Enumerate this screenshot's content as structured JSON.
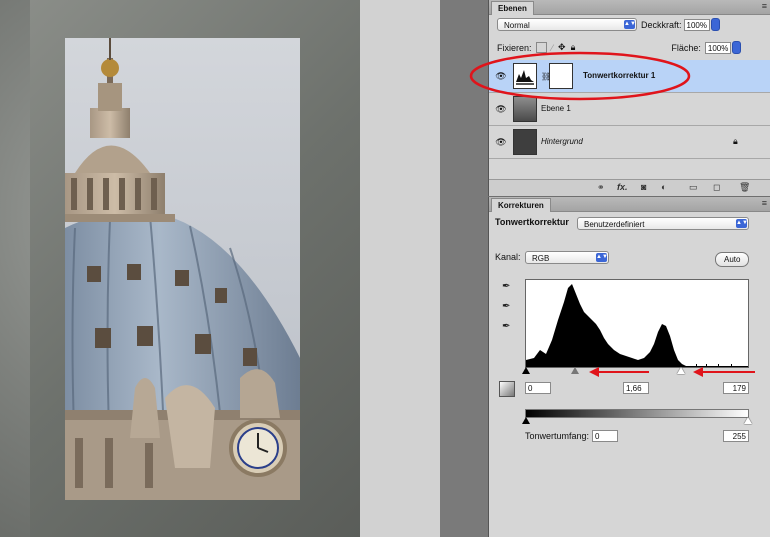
{
  "layers_panel": {
    "tab": "Ebenen",
    "menu_icon": "≡",
    "blend_mode": "Normal",
    "opacity_label": "Deckkraft:",
    "opacity_value": "100%",
    "lock_label": "Fixieren:",
    "fill_label": "Fläche:",
    "fill_value": "100%",
    "layers": [
      {
        "name": "Tonwertkorrektur 1",
        "selected": true
      },
      {
        "name": "Ebene 1",
        "selected": false
      },
      {
        "name": "Hintergrund",
        "selected": false,
        "locked": true
      }
    ],
    "footer_icons": [
      "link-icon",
      "fx-icon",
      "mask-icon",
      "adjustment-icon",
      "group-icon",
      "new-layer-icon",
      "trash-icon"
    ],
    "fx_label": "fx."
  },
  "adjustments_panel": {
    "tab": "Korrekturen",
    "title": "Tonwertkorrektur",
    "preset": "Benutzerdefiniert",
    "channel_label": "Kanal:",
    "channel": "RGB",
    "auto_label": "Auto",
    "input_black": "0",
    "input_gamma": "1,66",
    "input_white": "179",
    "output_label": "Tonwertumfang:",
    "output_black": "0",
    "output_white": "255"
  },
  "colors": {
    "selection": "#b9d3f7",
    "annotation_red": "#e0141b",
    "select_accent": "#3b66d6"
  }
}
